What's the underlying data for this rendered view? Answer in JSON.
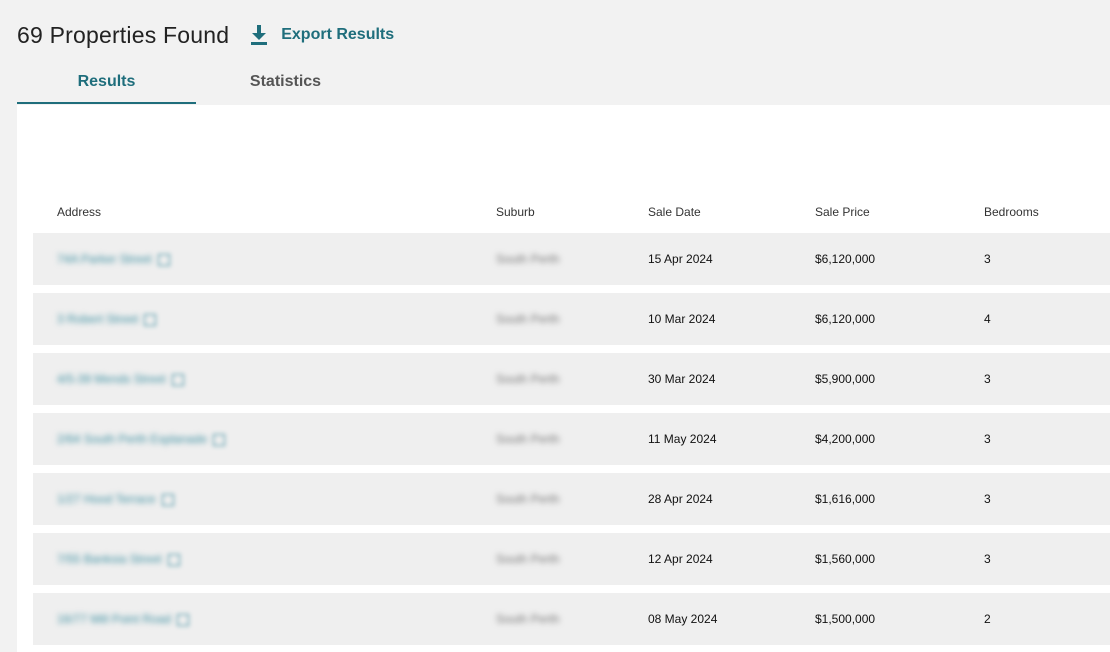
{
  "header": {
    "title": "69 Properties Found",
    "export_label": "Export Results",
    "export_icon": "download-icon",
    "accent": "#1f6e7c"
  },
  "tabs": [
    {
      "label": "Results",
      "active": true
    },
    {
      "label": "Statistics",
      "active": false
    }
  ],
  "table": {
    "columns": [
      "Address",
      "Suburb",
      "Sale Date",
      "Sale Price",
      "Bedrooms"
    ],
    "rows": [
      {
        "address": "74A Parker Street",
        "suburb": "South Perth",
        "sale_date": "15 Apr 2024",
        "sale_price": "$6,120,000",
        "bedrooms": "3"
      },
      {
        "address": "3 Robert Street",
        "suburb": "South Perth",
        "sale_date": "10 Mar 2024",
        "sale_price": "$6,120,000",
        "bedrooms": "4"
      },
      {
        "address": "4/5-39 Mends Street",
        "suburb": "South Perth",
        "sale_date": "30 Mar 2024",
        "sale_price": "$5,900,000",
        "bedrooms": "3"
      },
      {
        "address": "2/64 South Perth Esplanade",
        "suburb": "South Perth",
        "sale_date": "11 May 2024",
        "sale_price": "$4,200,000",
        "bedrooms": "3"
      },
      {
        "address": "1/27 Hood Terrace",
        "suburb": "South Perth",
        "sale_date": "28 Apr 2024",
        "sale_price": "$1,616,000",
        "bedrooms": "3"
      },
      {
        "address": "7/55 Banksia Street",
        "suburb": "South Perth",
        "sale_date": "12 Apr 2024",
        "sale_price": "$1,560,000",
        "bedrooms": "3"
      },
      {
        "address": "16/77 Mill Point Road",
        "suburb": "South Perth",
        "sale_date": "08 May 2024",
        "sale_price": "$1,500,000",
        "bedrooms": "2"
      }
    ]
  }
}
